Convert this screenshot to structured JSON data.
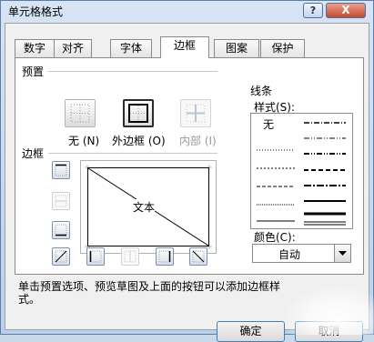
{
  "window": {
    "title": "单元格格式",
    "help_button": "?",
    "close_button": "X"
  },
  "tabs": [
    {
      "label": "数字",
      "active": false
    },
    {
      "label": "对齐",
      "active": false
    },
    {
      "label": "字体",
      "active": false
    },
    {
      "label": "边框",
      "active": true
    },
    {
      "label": "图案",
      "active": false
    },
    {
      "label": "保护",
      "active": false
    }
  ],
  "presets": {
    "title": "预置",
    "items": [
      {
        "label": "无 (N)",
        "icon": "border-none-icon",
        "state": "normal"
      },
      {
        "label": "外边框 (O)",
        "icon": "border-outline-icon",
        "state": "selected"
      },
      {
        "label": "内部 (I)",
        "icon": "border-inside-icon",
        "state": "disabled"
      }
    ]
  },
  "border": {
    "title": "边框",
    "side_buttons": [
      {
        "icon": "border-top-icon",
        "state": "pressed"
      },
      {
        "icon": "border-middle-horizontal-icon",
        "state": "disabled"
      },
      {
        "icon": "border-bottom-icon",
        "state": "pressed"
      }
    ],
    "bottom_buttons": [
      {
        "icon": "border-diagonal-up-icon",
        "state": "normal"
      },
      {
        "icon": "border-left-icon",
        "state": "pressed"
      },
      {
        "icon": "border-middle-vertical-icon",
        "state": "disabled"
      },
      {
        "icon": "border-right-icon",
        "state": "pressed"
      },
      {
        "icon": "border-diagonal-down-icon",
        "state": "pressed"
      }
    ],
    "preview_text": "文本"
  },
  "line": {
    "title": "线条",
    "style_label": "样式(S):",
    "none_label": "无",
    "color_label": "颜色(C):",
    "color_value": "自动"
  },
  "hint": "单击预置选项、预览草图及上面的按钮可以添加边框样式。",
  "buttons": {
    "ok": "确定",
    "cancel": "取消"
  }
}
